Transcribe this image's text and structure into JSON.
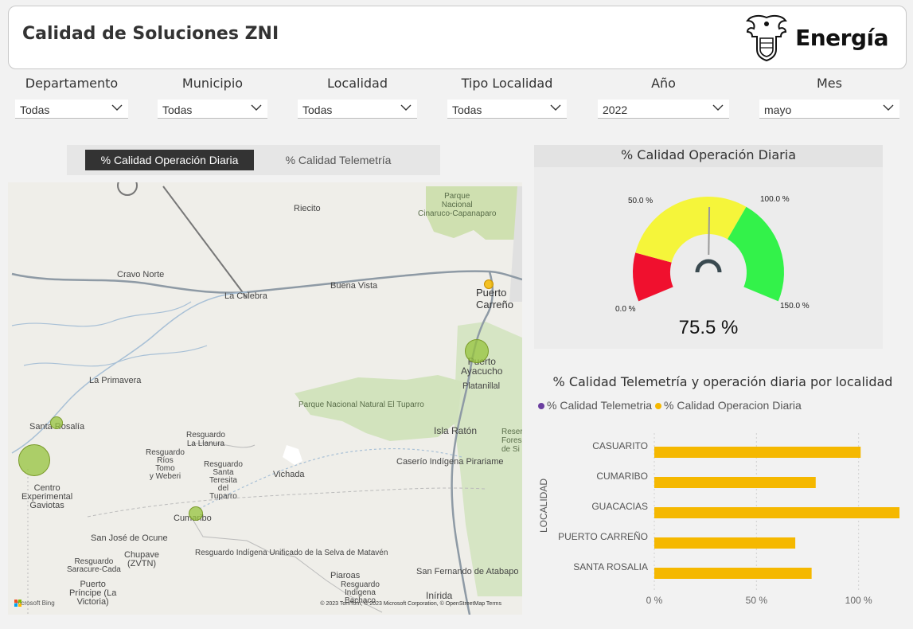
{
  "header": {
    "title": "Calidad de Soluciones ZNI",
    "brand": "Energía"
  },
  "filters": [
    {
      "label": "Departamento",
      "value": "Todas"
    },
    {
      "label": "Municipio",
      "value": "Todas"
    },
    {
      "label": "Localidad",
      "value": "Todas"
    },
    {
      "label": "Tipo Localidad",
      "value": "Todas"
    },
    {
      "label": "Año",
      "value": "2022"
    },
    {
      "label": "Mes",
      "value": "mayo"
    }
  ],
  "toggle": {
    "active": "% Calidad Operación Diaria",
    "inactive": "% Calidad Telemetría"
  },
  "map": {
    "labels": {
      "parque_cinaruco": "Parque\nNacional\nCinaruco-Capanaparo",
      "riecito": "Riecito",
      "cravo_norte": "Cravo Norte",
      "buena_vista": "Buena Vista",
      "la_culebra": "La Culebra",
      "puerto_carreno": "Puerto\nCarreño",
      "puerto_ayacucho": "Puerto\nAyacucho",
      "platanillal": "Platanillal",
      "la_primavera": "La Primavera",
      "parque_tuparro": "Parque Nacional Natural El Tuparro",
      "santa_rosalia": "Santa Rosalía",
      "isla_raton": "Isla Ratón",
      "reserva": "Reserv\nFores\nde Si",
      "res_la_llanura": "Resguardo\nLa Llanura",
      "res_rios_tomo": "Resguardo\nRíos\nTomo\ny Weberi",
      "res_santa_teresita": "Resguardo\nSanta\nTeresita\ndel\nTuparro",
      "vichada": "Vichada",
      "caserio": "Caserío Indígena Pirariame",
      "centro_gaviotas": "Centro\nExperimental\nGaviotas",
      "cumaribo": "Cumaribo",
      "san_jose_ocune": "San José de Ocune",
      "chupave": "Chupave\n(ZVTN)",
      "res_matavén": "Resguardo Indígena Unificado de la Selva de Matavén",
      "res_saracure": "Resguardo\nSaracure-Cada",
      "san_fernando": "San Fernando de Atabapo",
      "piaroas": "Piaroas",
      "res_indigena": "Resguardo\nIndígena\nBachaco",
      "puerto_principe": "Puerto\nPríncipe (La\nVictoria)",
      "inirida": "Inírida"
    },
    "attribution": "© 2023 TomTom, © 2023 Microsoft Corporation, © OpenStreetMap  Terms",
    "bing": "Microsoft Bing"
  },
  "gauge": {
    "title": "% Calidad Operación Diaria",
    "value_label": "75.5 %",
    "value": 75.5,
    "min": 0,
    "max": 150,
    "tick_labels": {
      "min": "0.0 %",
      "t50": "50.0 %",
      "t100": "100.0 %",
      "max": "150.0 %"
    },
    "colors": {
      "low": "#f0102e",
      "mid": "#f5f53a",
      "high": "#33f24a",
      "needle": "#999999"
    }
  },
  "bar_chart": {
    "title": "% Calidad Telemetría y operación diaria por localidad",
    "legend": [
      "% Calidad Telemetria",
      "% Calidad Operacion Diaria"
    ],
    "legend_colors": [
      "#6b3fa0",
      "#f5b800"
    ],
    "y_label": "LOCALIDAD"
  },
  "chart_data": {
    "type": "bar",
    "orientation": "horizontal",
    "categories": [
      "CASUARITO",
      "CUMARIBO",
      "GUACACIAS",
      "PUERTO CARREÑO",
      "SANTA ROSALIA"
    ],
    "series": [
      {
        "name": "% Calidad Telemetria",
        "values": [
          0,
          0,
          0,
          0,
          0
        ]
      },
      {
        "name": "% Calidad Operacion Diaria",
        "values": [
          101,
          79,
          120,
          69,
          77
        ]
      }
    ],
    "x_ticks": [
      "0 %",
      "50 %",
      "100 %"
    ],
    "xlim": [
      0,
      120
    ],
    "grid": true,
    "bar_color": "#f5b800"
  }
}
